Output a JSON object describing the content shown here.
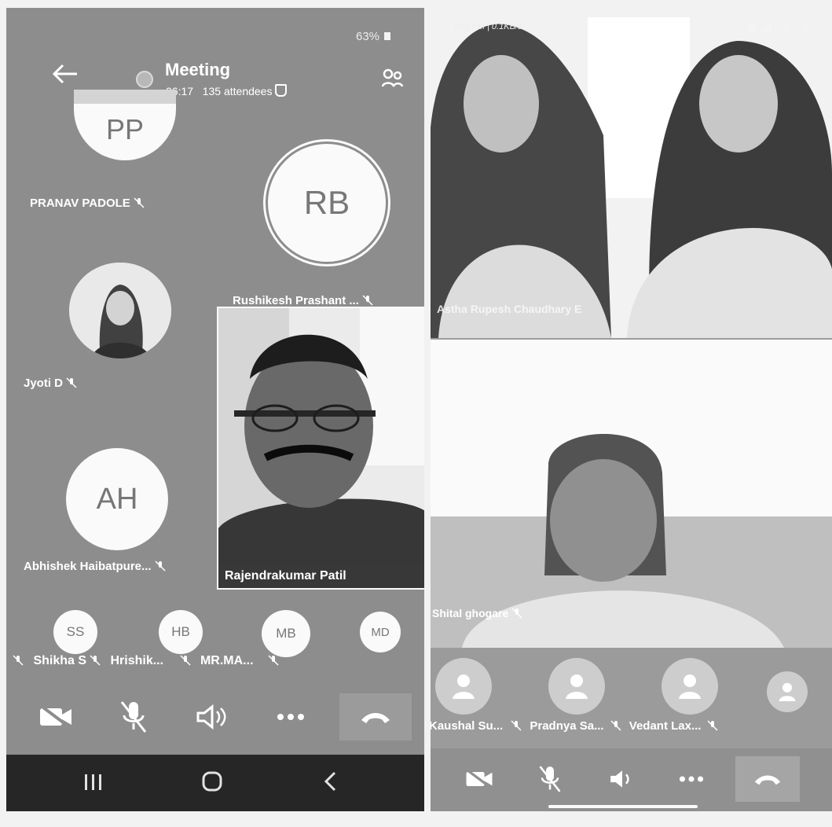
{
  "left": {
    "status": {
      "battery": "63%"
    },
    "header": {
      "title": "Meeting",
      "time": "06:17",
      "attendees": "135 attendees"
    },
    "participants": [
      {
        "initials": "PP",
        "name": "PRANAV PADOLE"
      },
      {
        "initials": "RB",
        "name": "Rushikesh Prashant ..."
      },
      {
        "initials": "",
        "name": "Jyoti D"
      },
      {
        "initials": "AH",
        "name": "Abhishek Haibatpure..."
      },
      {
        "initials": "",
        "name": "Rajendrakumar Patil"
      }
    ],
    "small_participants": [
      {
        "initials": "SS",
        "name": "Shikha S"
      },
      {
        "initials": "HB",
        "name": "Hrishik..."
      },
      {
        "initials": "MB",
        "name": "MR.MA..."
      },
      {
        "initials": "MD",
        "name": ""
      }
    ]
  },
  "right": {
    "status": {
      "time": "3:01 PM | 0.1KB/s"
    },
    "tiles": [
      {
        "name": "Astha Rupesh Chaudhary E"
      },
      {
        "name": "Shital ghogare"
      }
    ],
    "small_participants": [
      {
        "name": "Kaushal Su..."
      },
      {
        "name": "Pradnya Sa..."
      },
      {
        "name": "Vedant Lax..."
      },
      {
        "name": ""
      }
    ]
  }
}
